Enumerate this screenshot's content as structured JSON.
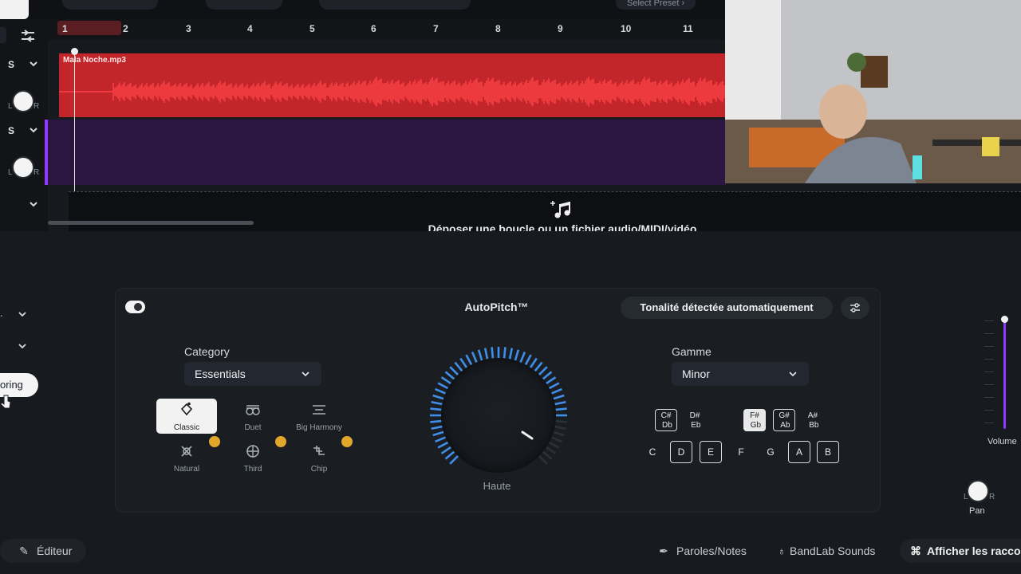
{
  "top": {
    "preset_label": "Select Preset"
  },
  "timeline": {
    "ruler_numbers": [
      "1",
      "2",
      "3",
      "4",
      "5",
      "6",
      "7",
      "8",
      "9",
      "10",
      "11"
    ],
    "clip_name": "Mala Noche.mp3",
    "drop_text": "Déposer une boucle ou un fichier audio/MIDI/vidéo"
  },
  "tracks": [
    {
      "solo": "S",
      "pan_l": "L",
      "pan_r": "R"
    },
    {
      "solo": "S",
      "pan_l": "L",
      "pan_r": "R"
    }
  ],
  "effect": {
    "title": "AutoPitch™",
    "key_detect_label": "Tonalité détectée automatiquement",
    "category_label": "Category",
    "category_value": "Essentials",
    "scale_label": "Gamme",
    "scale_value": "Minor",
    "knob_label": "Haute",
    "knob_level": 0.85,
    "presets": [
      {
        "name": "Classic",
        "active": true
      },
      {
        "name": "Duet",
        "active": false
      },
      {
        "name": "Big Harmony",
        "active": false
      },
      {
        "name": "Natural",
        "premium": true
      },
      {
        "name": "Third",
        "premium": true
      },
      {
        "name": "Chip",
        "premium": true
      }
    ],
    "sharps": [
      {
        "top": "C#",
        "bottom": "Db"
      },
      {
        "top": "D#",
        "bottom": "Eb"
      },
      {
        "top": "F#",
        "bottom": "Gb"
      },
      {
        "top": "G#",
        "bottom": "Ab"
      },
      {
        "top": "A#",
        "bottom": "Bb"
      }
    ],
    "notes": [
      "C",
      "D",
      "E",
      "F",
      "G",
      "A",
      "B"
    ]
  },
  "left": {
    "monitoring_text": "oring"
  },
  "right": {
    "volume_label": "Volume",
    "pan_label": "Pan",
    "pan_l": "L",
    "pan_r": "R"
  },
  "bottom": {
    "editor_label": "Éditeur",
    "lyrics_label": "Paroles/Notes",
    "sounds_label": "BandLab Sounds",
    "shortcuts_label": "Afficher les raccou"
  },
  "colors": {
    "clip": "#c2252a",
    "accent_purple": "#8d3bff",
    "knob_arc": "#3f8ee8"
  }
}
